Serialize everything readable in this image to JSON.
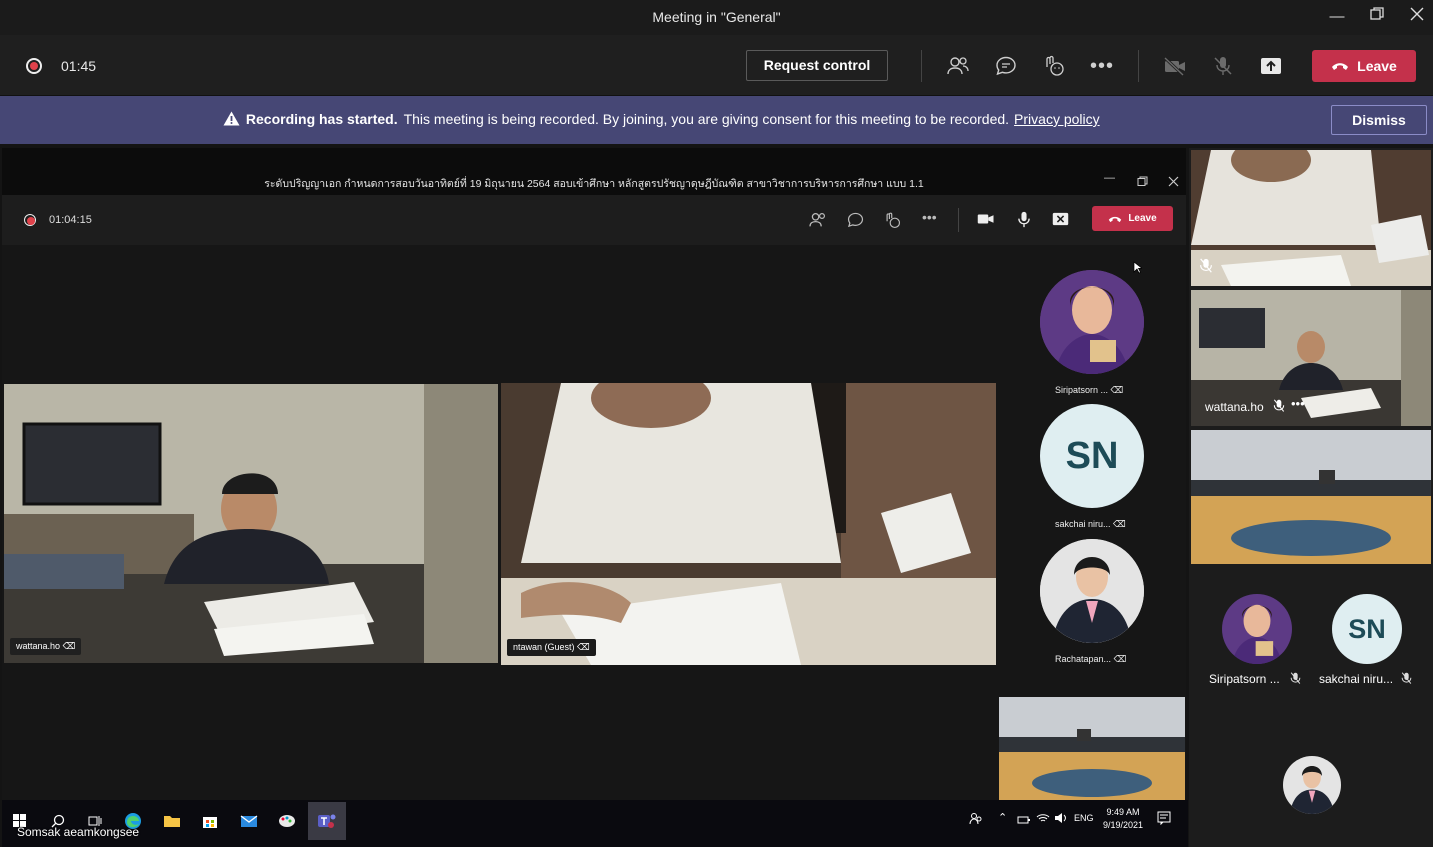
{
  "window": {
    "title": "Meeting in \"General\""
  },
  "toolbar": {
    "timer": "01:45",
    "request_control": "Request control",
    "leave": "Leave",
    "icons": [
      "participants-icon",
      "chat-icon",
      "reactions-icon",
      "more-icon",
      "camera-off-icon",
      "mic-off-icon",
      "share-tray-icon"
    ]
  },
  "banner": {
    "bold": "Recording has started.",
    "message": "This meeting is being recorded. By joining, you are giving consent for this meeting to be recorded.",
    "link": "Privacy policy",
    "dismiss": "Dismiss"
  },
  "shared_screen": {
    "window_title": "ระดับปริญญาเอก กำหนดการสอบวันอาทิตย์ที่ 19 มิถุนายน 2564 สอบเข้าศึกษา หลักสูตรปรัชญาดุษฎีบัณฑิต สาขาวิชาการบริหารการศึกษา แบบ 1.1",
    "timer": "01:04:15",
    "leave": "Leave",
    "videos": [
      {
        "name": "wattana.ho"
      },
      {
        "name": "ntawan (Guest)"
      }
    ],
    "participants": [
      {
        "name": "Siripatsorn ...",
        "avatar": "photo"
      },
      {
        "name": "sakchai niru...",
        "initials": "SN"
      },
      {
        "name": "Rachatapan...",
        "avatar": "photo"
      }
    ],
    "taskbar": {
      "user": "Somsak aeamkongsee",
      "lang": "ENG",
      "time": "9:49 AM",
      "date": "9/19/2021"
    }
  },
  "gallery": {
    "tiles": [
      {
        "name": ""
      },
      {
        "name": "wattana.ho"
      },
      {
        "name": ""
      }
    ],
    "people": [
      {
        "name": "Siripatsorn ...",
        "avatar": "photo"
      },
      {
        "name": "sakchai niru...",
        "initials": "SN"
      }
    ]
  },
  "colors": {
    "leave": "#c4314b",
    "banner": "#464775",
    "recording": "#e0424b"
  }
}
